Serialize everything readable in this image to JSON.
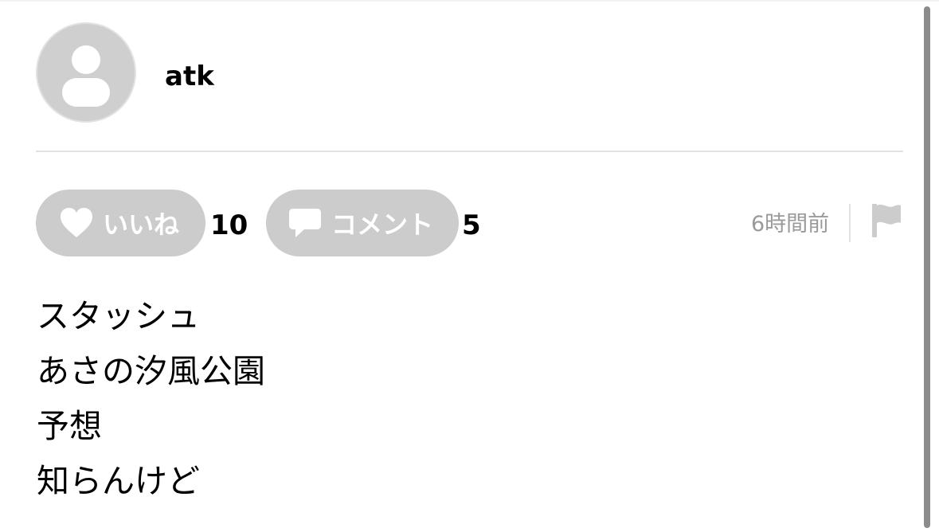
{
  "header": {
    "avatar_icon": "user-avatar-icon",
    "username": "atk"
  },
  "actions": {
    "like": {
      "label": "いいね",
      "icon": "heart-icon",
      "count": "10"
    },
    "comment": {
      "label": "コメント",
      "icon": "speech-bubble-icon",
      "count": "5"
    },
    "timestamp": "6時間前",
    "report_icon": "flag-icon"
  },
  "post": {
    "lines": [
      "スタッシュ",
      "あさの汐風公園",
      "予想",
      "知らんけど"
    ]
  },
  "colors": {
    "pill_bg": "#cccccc",
    "muted_text": "#9a9a9a",
    "divider": "#e2e2e2"
  }
}
